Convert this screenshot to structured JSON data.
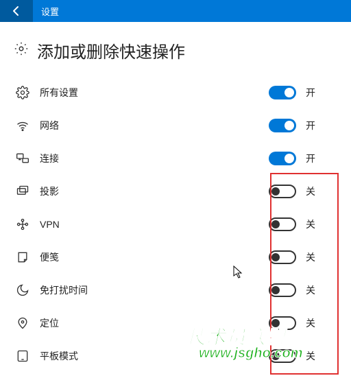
{
  "titlebar": {
    "title": "设置"
  },
  "header": {
    "title": "添加或删除快速操作"
  },
  "state": {
    "on": "开",
    "off": "关"
  },
  "rows": [
    {
      "label": "所有设置",
      "on": true
    },
    {
      "label": "网络",
      "on": true
    },
    {
      "label": "连接",
      "on": true
    },
    {
      "label": "投影",
      "on": false
    },
    {
      "label": "VPN",
      "on": false
    },
    {
      "label": "便笺",
      "on": false
    },
    {
      "label": "免打扰时间",
      "on": false
    },
    {
      "label": "定位",
      "on": false
    },
    {
      "label": "平板模式",
      "on": false
    }
  ],
  "watermark": {
    "line1": "技术员联盟",
    "line2": "www.jsgho.com"
  }
}
